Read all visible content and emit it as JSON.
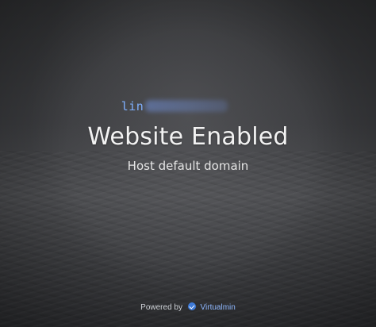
{
  "host": {
    "visible_prefix": "lin"
  },
  "main": {
    "title": "Website Enabled",
    "subtitle": "Host default domain"
  },
  "footer": {
    "powered_by": "Powered by",
    "brand": "Virtualmin",
    "brand_icon": "virtualmin-check-icon",
    "brand_color": "#8fb8ff"
  }
}
